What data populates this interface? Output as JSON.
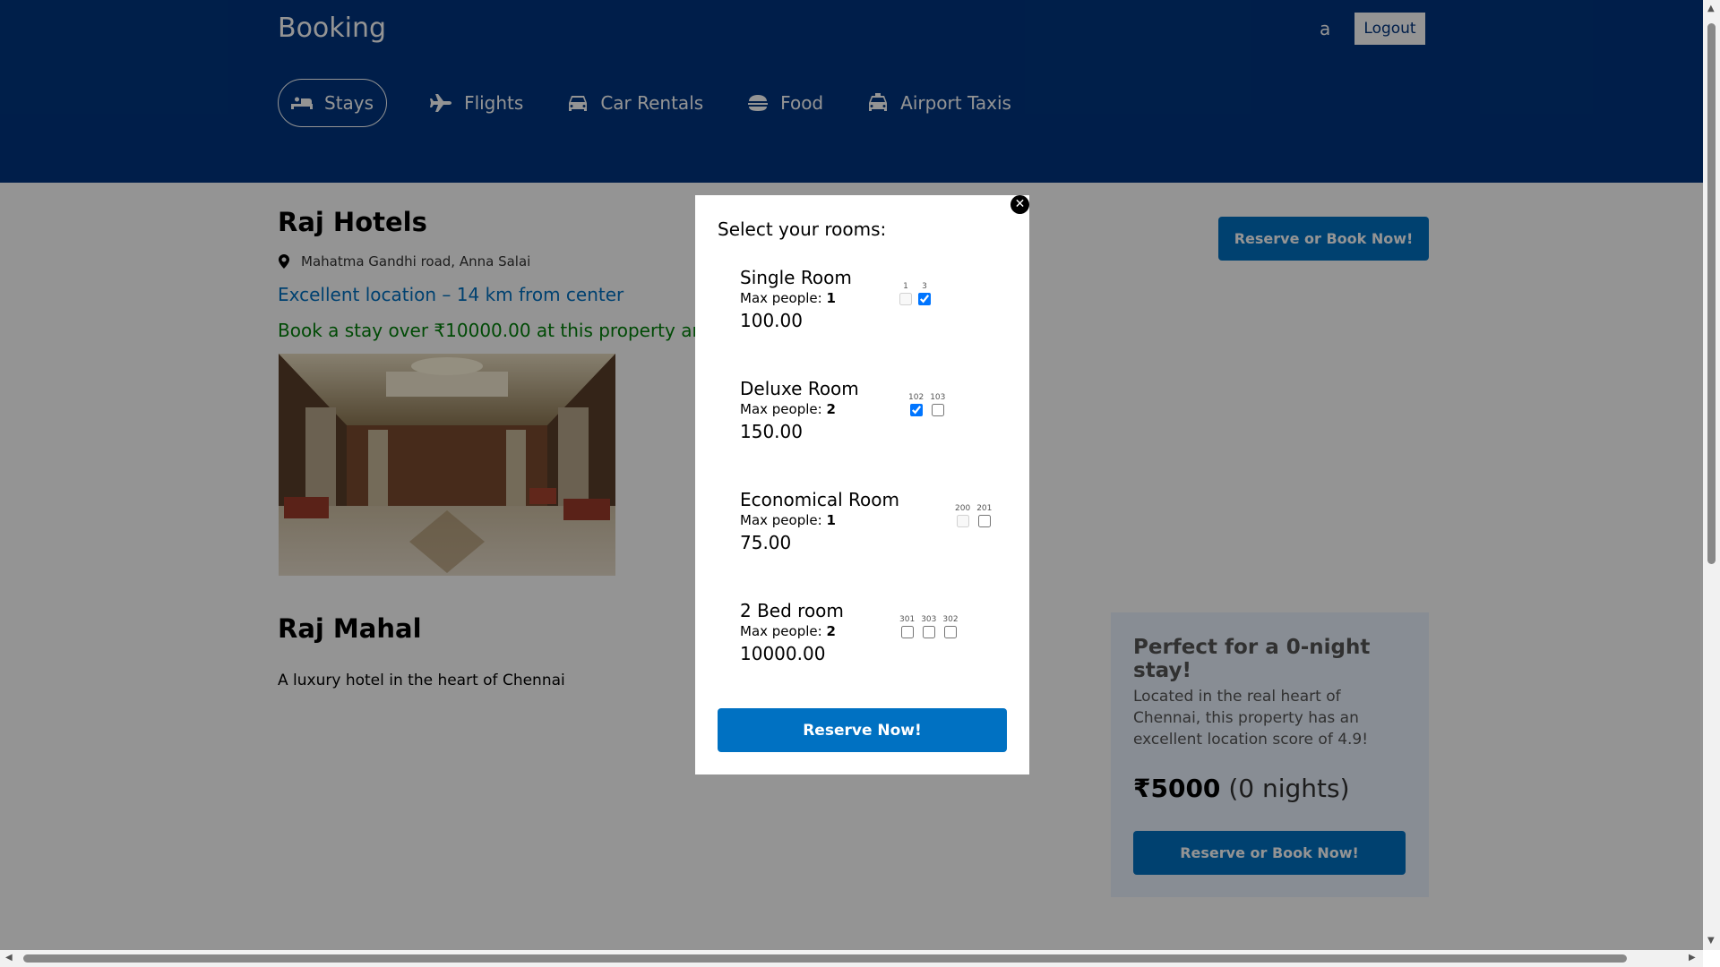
{
  "header": {
    "brand": "Booking",
    "user": "a",
    "logout_label": "Logout",
    "nav": [
      {
        "label": "Stays",
        "icon": "bed-icon",
        "active": true
      },
      {
        "label": "Flights",
        "icon": "plane-icon"
      },
      {
        "label": "Car Rentals",
        "icon": "car-icon"
      },
      {
        "label": "Food",
        "icon": "food-icon"
      },
      {
        "label": "Airport Taxis",
        "icon": "taxi-icon"
      }
    ]
  },
  "hotel": {
    "name": "Raj Hotels",
    "address": "Mahatma Gandhi road, Anna Salai",
    "location": "Excellent location – 14 km from center",
    "promo": "Book a stay over ₹10000.00 at this property and g",
    "subtitle": "Raj Mahal",
    "description": "A luxury hotel in the heart of Chennai",
    "reserve_label": "Reserve or Book Now!"
  },
  "side": {
    "title": "Perfect for a 0-night stay!",
    "text": "Located in the real heart of Chennai, this property has an excellent location score of 4.9!",
    "price": "₹5000",
    "nights": "(0 nights)",
    "reserve_label": "Reserve or Book Now!"
  },
  "modal": {
    "title": "Select your rooms:",
    "max_label": "Max people: ",
    "reserve_label": "Reserve Now!",
    "rooms": [
      {
        "name": "Single Room",
        "max": "1",
        "price": "100.00",
        "numbers": [
          {
            "n": "1",
            "checked": false,
            "disabled": true
          },
          {
            "n": "3",
            "checked": true,
            "disabled": false
          }
        ]
      },
      {
        "name": "Deluxe Room",
        "max": "2",
        "price": "150.00",
        "numbers": [
          {
            "n": "102",
            "checked": true,
            "disabled": false
          },
          {
            "n": "103",
            "checked": false,
            "disabled": false
          }
        ]
      },
      {
        "name": "Economical Room",
        "max": "1",
        "price": "75.00",
        "numbers": [
          {
            "n": "200",
            "checked": false,
            "disabled": true
          },
          {
            "n": "201",
            "checked": false,
            "disabled": false
          }
        ]
      },
      {
        "name": "2 Bed room",
        "max": "2",
        "price": "10000.00",
        "numbers": [
          {
            "n": "301",
            "checked": false,
            "disabled": false
          },
          {
            "n": "303",
            "checked": false,
            "disabled": false
          },
          {
            "n": "302",
            "checked": false,
            "disabled": false
          }
        ]
      }
    ]
  }
}
